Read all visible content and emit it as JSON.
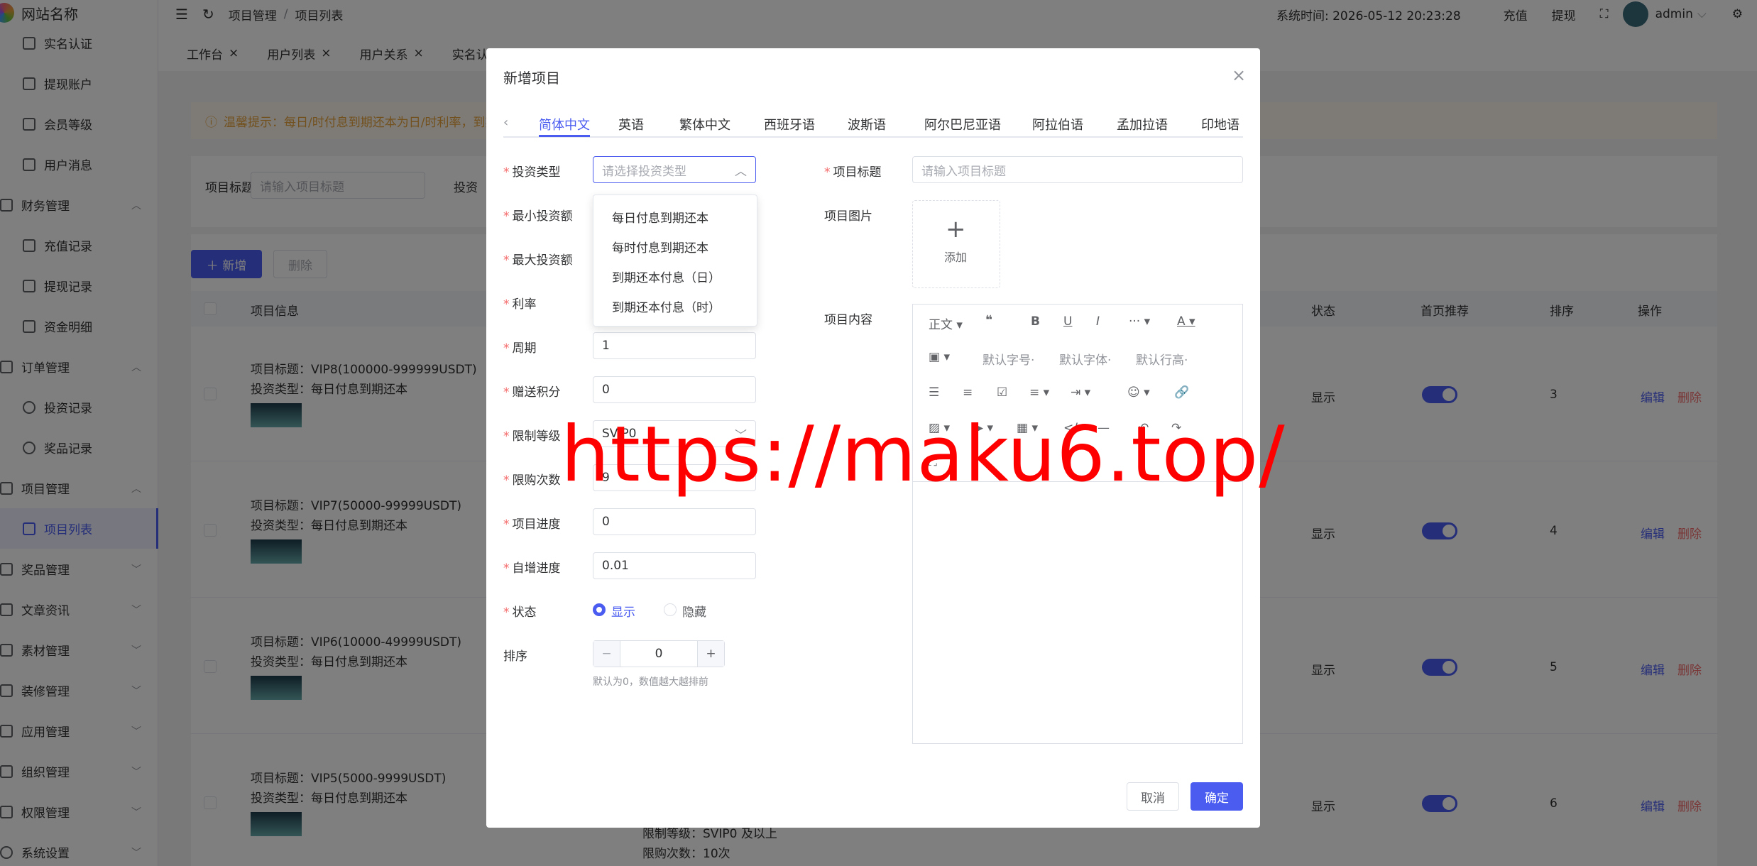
{
  "app": {
    "site_name": "网站名称",
    "breadcrumb_1": "项目管理",
    "breadcrumb_sep": "/",
    "breadcrumb_2": "项目列表",
    "system_time": "系统时间: 2026-05-12 20:23:28",
    "recharge": "充值",
    "withdraw": "提现",
    "user": "admin"
  },
  "sidebar": {
    "items": [
      {
        "label": "实名认证",
        "icon": "id-card-icon"
      },
      {
        "label": "提现账户",
        "icon": "folder-icon"
      },
      {
        "label": "会员等级",
        "icon": "rocket-icon"
      },
      {
        "label": "用户消息",
        "icon": "chat-icon"
      },
      {
        "label": "财务管理",
        "icon": "finance-icon"
      },
      {
        "label": "充值记录",
        "icon": "folder-icon"
      },
      {
        "label": "提现记录",
        "icon": "folder-icon"
      },
      {
        "label": "资金明细",
        "icon": "wallet-icon"
      },
      {
        "label": "订单管理",
        "icon": "order-icon"
      },
      {
        "label": "投资记录",
        "icon": "clock-icon"
      },
      {
        "label": "奖品记录",
        "icon": "clock-icon"
      },
      {
        "label": "项目管理",
        "icon": "project-icon"
      },
      {
        "label": "项目列表",
        "icon": "list-icon"
      },
      {
        "label": "奖品管理",
        "icon": "gift-icon"
      },
      {
        "label": "文章资讯",
        "icon": "article-icon"
      },
      {
        "label": "素材管理",
        "icon": "image-icon"
      },
      {
        "label": "装修管理",
        "icon": "decor-icon"
      },
      {
        "label": "应用管理",
        "icon": "app-icon"
      },
      {
        "label": "组织管理",
        "icon": "org-icon"
      },
      {
        "label": "权限管理",
        "icon": "lock-icon"
      },
      {
        "label": "系统设置",
        "icon": "gear-icon"
      }
    ]
  },
  "tabs": {
    "t1": "工作台",
    "t2": "用户列表",
    "t3": "用户关系",
    "t4": "实名认"
  },
  "page": {
    "notice": "温馨提示：每日/时付息到期还本为日/时利率，到期",
    "filter_label": "项目标题",
    "filter_placeholder": "请输入项目标题",
    "filter_label2": "投资",
    "add_btn": "新增",
    "del_btn": "删除",
    "col_info": "项目信息",
    "col_status": "状态",
    "col_home": "首页推荐",
    "col_sort": "排序",
    "col_op": "操作",
    "rows": [
      {
        "title": "项目标题：VIP8(100000-999999USDT)",
        "type": "投资类型：每日付息到期还本",
        "status": "显示",
        "sort": "3",
        "edit": "编辑",
        "del": "删除"
      },
      {
        "title": "项目标题：VIP7(50000-99999USDT)",
        "type": "投资类型：每日付息到期还本",
        "status": "显示",
        "sort": "4",
        "edit": "编辑",
        "del": "删除"
      },
      {
        "title": "项目标题：VIP6(10000-49999USDT)",
        "type": "投资类型：每日付息到期还本",
        "status": "显示",
        "sort": "5",
        "edit": "编辑",
        "del": "删除"
      },
      {
        "title": "项目标题：VIP5(5000-9999USDT)",
        "type": "投资类型：每日付息到期还本",
        "status": "显示",
        "sort": "6",
        "edit": "编辑",
        "del": "删除"
      }
    ],
    "extra1": "限制等级：SVIP0 及以上",
    "extra2": "限购次数：10次"
  },
  "dialog": {
    "title": "新增项目",
    "lang_tabs": [
      "简体中文",
      "英语",
      "繁体中文",
      "西班牙语",
      "波斯语",
      "阿尔巴尼亚语",
      "阿拉伯语",
      "孟加拉语",
      "印地语"
    ],
    "invest_type_label": "投资类型",
    "invest_type_placeholder": "请选择投资类型",
    "dropdown_options": [
      "每日付息到期还本",
      "每时付息到期还本",
      "到期还本付息（日）",
      "到期还本付息（时）"
    ],
    "min_label": "最小投资额",
    "max_label": "最大投资额",
    "rate_label": "利率",
    "period_label": "周期",
    "period_value": "1",
    "points_label": "赠送积分",
    "points_value": "0",
    "level_label": "限制等级",
    "level_value": "SVIP0",
    "limit_label": "限购次数",
    "limit_value": "9",
    "progress_label": "项目进度",
    "progress_value": "0",
    "auto_label": "自增进度",
    "auto_value": "0.01",
    "status_label": "状态",
    "status_show": "显示",
    "status_hide": "隐藏",
    "sort_label": "排序",
    "sort_value": "0",
    "sort_hint": "默认为0，数值越大越排前",
    "title_label": "项目标题",
    "title_placeholder": "请输入项目标题",
    "image_label": "项目图片",
    "upload_text": "添加",
    "content_label": "项目内容",
    "toolbar": {
      "para": "正文",
      "font_size": "默认字号",
      "font_family": "默认字体",
      "line_height": "默认行高"
    },
    "cancel": "取消",
    "confirm": "确定"
  },
  "watermark": "https://maku6.top/"
}
